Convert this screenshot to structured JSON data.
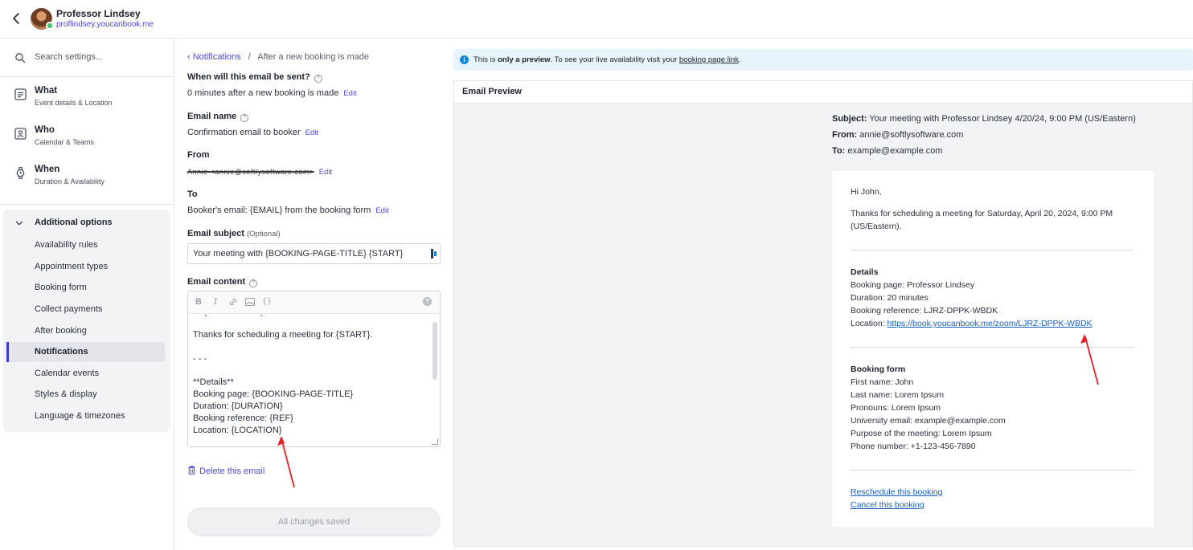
{
  "header": {
    "user_name": "Professor Lindsey",
    "user_url": "proflindsey.youcanbook.me"
  },
  "sidebar": {
    "search_placeholder": "Search settings...",
    "main_items": [
      {
        "title": "What",
        "subtitle": "Event details & Location",
        "icon": "clipboard-icon"
      },
      {
        "title": "Who",
        "subtitle": "Calendar & Teams",
        "icon": "contact-card-icon"
      },
      {
        "title": "When",
        "subtitle": "Duration & Availability",
        "icon": "watch-icon"
      }
    ],
    "additional_label": "Additional options",
    "sub_items": [
      "Availability rules",
      "Appointment types",
      "Booking form",
      "Collect payments",
      "After booking",
      "Notifications",
      "Calendar events",
      "Styles & display",
      "Language & timezones"
    ],
    "active_sub_item": "Notifications"
  },
  "editor_panel": {
    "breadcrumb_parent": "Notifications",
    "breadcrumb_separator": "/",
    "breadcrumb_current": "After a new booking is made",
    "when_label": "When will this email be sent?",
    "when_value": "0 minutes after a new booking is made",
    "email_name_label": "Email name",
    "email_name_value": "Confirmation email to booker",
    "from_label": "From",
    "from_value": "Annie <annie@softlysoftware.com>",
    "to_label": "To",
    "to_value": "Booker's email: {EMAIL} from the booking form",
    "edit_label": "Edit",
    "subject_label": "Email subject",
    "subject_optional": "(Optional)",
    "subject_value": "Your meeting with {BOOKING-PAGE-TITLE} {START}",
    "content_label": "Email content",
    "toolbar": [
      "B",
      "I",
      "link",
      "image",
      "{}"
    ],
    "content_lines": [
      "Thanks for scheduling a meeting for {START}.",
      "",
      "- - -",
      "",
      "**Details**",
      "Booking page: {BOOKING-PAGE-TITLE}",
      "Duration: {DURATION}",
      "Booking reference: {REF}",
      "Location: {LOCATION}"
    ],
    "delete_label": "Delete this email",
    "saved_label": "All changes saved"
  },
  "notice": {
    "prefix": "This is ",
    "bold": "only a preview",
    "middle": ". To see your live availability visit your ",
    "link": "booking page link",
    "suffix": "."
  },
  "preview": {
    "title": "Email Preview",
    "subject_label": "Subject:",
    "subject_value": "Your meeting with Professor Lindsey 4/20/24, 9:00 PM (US/Eastern)",
    "from_label": "From:",
    "from_value": "annie@softlysoftware.com",
    "to_label": "To:",
    "to_value": "example@example.com",
    "greeting": "Hi John,",
    "thanks_line1": "Thanks for scheduling a meeting for Saturday, April 20, 2024, 9:00 PM",
    "thanks_line2": "(US/Eastern).",
    "details_heading": "Details",
    "details": [
      "Booking page: Professor Lindsey",
      "Duration: 20 minutes",
      "Booking reference: LJRZ-DPPK-WBDK"
    ],
    "location_label": "Location: ",
    "location_link": "https://book.youcanbook.me/zoom/LJRZ-DPPK-WBDK",
    "form_heading": "Booking form",
    "form_fields": [
      "First name: John",
      "Last name: Lorem Ipsum",
      "Pronouns: Lorem Ipsum",
      "University email: example@example.com",
      "Purpose of the meeting: Lorem Ipsum",
      "Phone number: +1-123-456-7890"
    ],
    "reschedule_link": "Reschedule this booking",
    "cancel_link": "Cancel this booking"
  },
  "colors": {
    "accent": "#4a49d6",
    "active_bar": "#3b3ad1",
    "annotation_arrow": "#e8202a",
    "notice_bg": "#e8f4fb",
    "link_blue": "#1a5fc0"
  }
}
